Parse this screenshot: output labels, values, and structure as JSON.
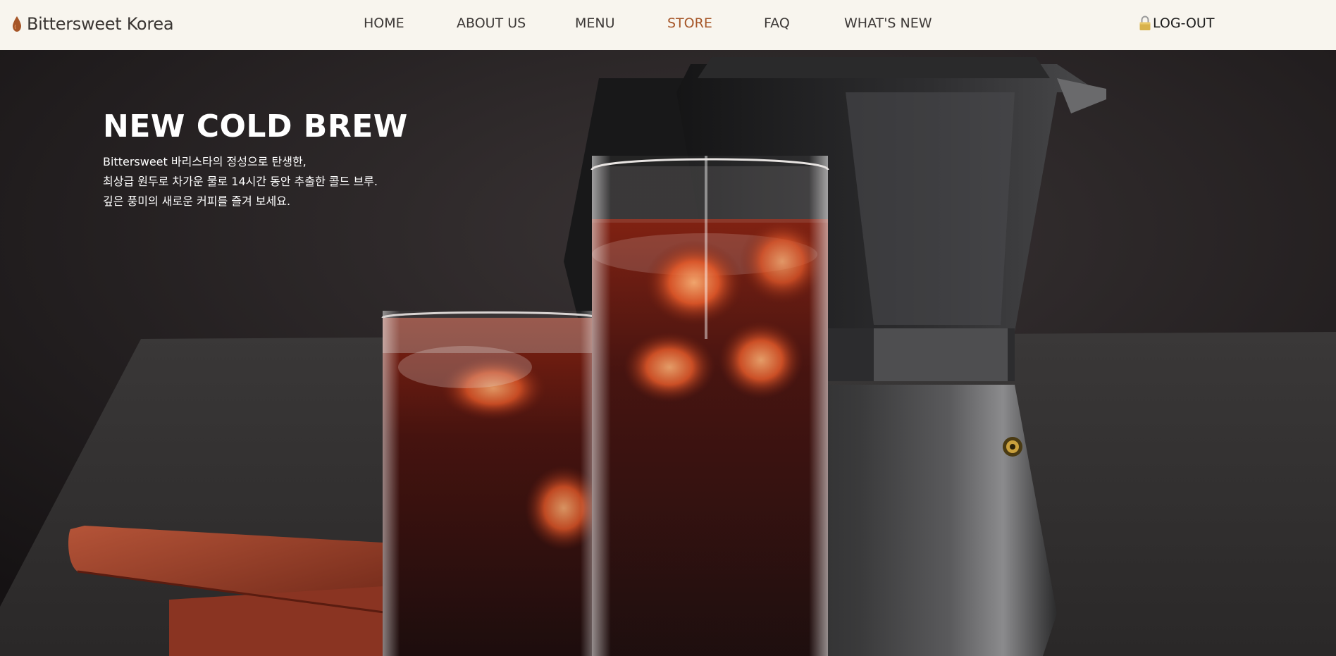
{
  "brand": {
    "name": "Bittersweet Korea",
    "logo_icon": "coffee-drop-icon",
    "accent": "#a65628"
  },
  "nav": {
    "items": [
      {
        "label": "HOME"
      },
      {
        "label": "ABOUT US"
      },
      {
        "label": "MENU"
      },
      {
        "label": "STORE",
        "active": true
      },
      {
        "label": "FAQ"
      },
      {
        "label": "WHAT'S NEW"
      }
    ],
    "logout": {
      "label": "LOG-OUT",
      "icon": "lock-icon"
    }
  },
  "hero": {
    "title": "NEW COLD BREW",
    "lines": [
      "Bittersweet 바리스타의 정성으로 탄생한,",
      "최상급 원두로 차가운 물로 14시간 동안 추출한 콜드 브루.",
      "깊은 풍미의 새로운 커피를 즐겨 보세요."
    ]
  }
}
